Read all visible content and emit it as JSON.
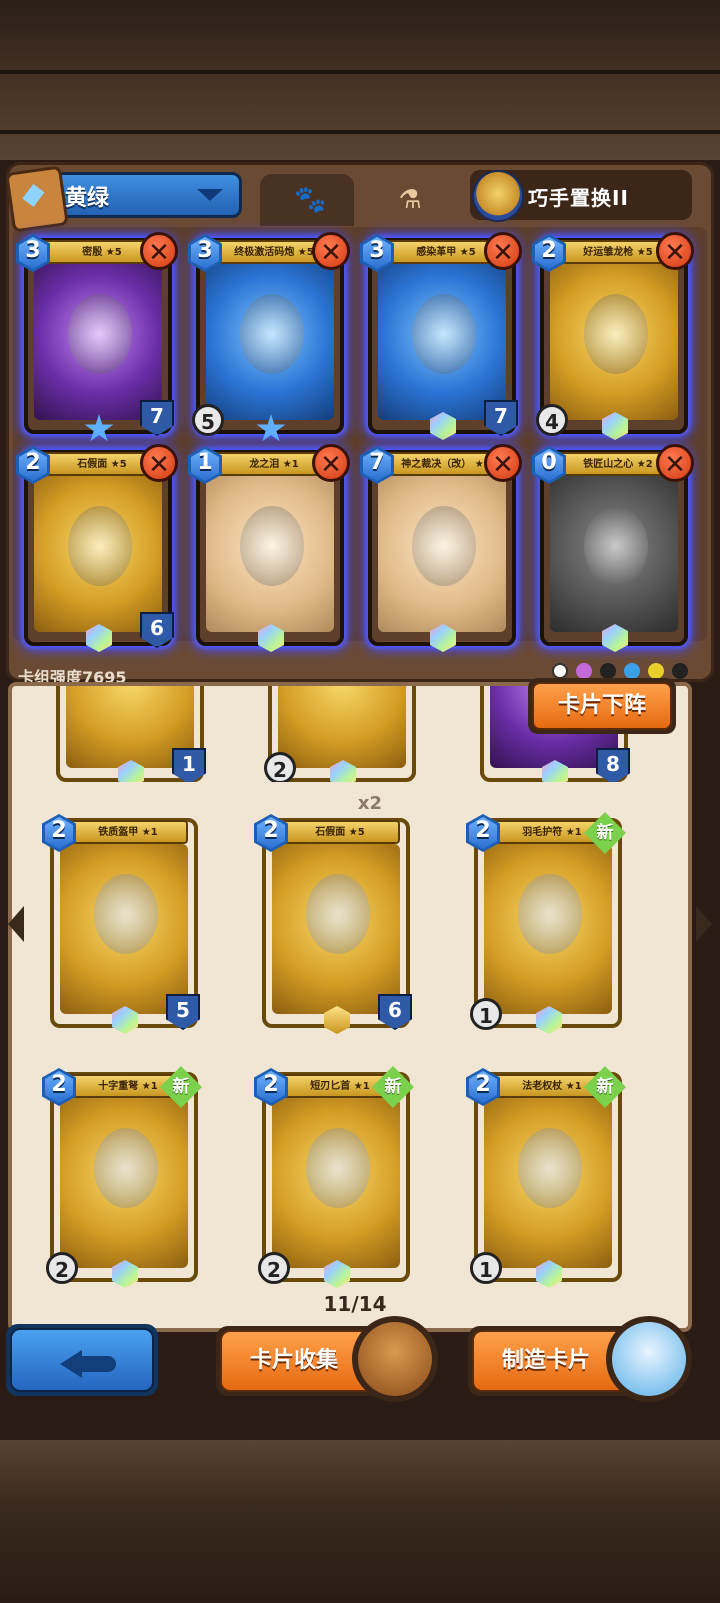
{
  "deck": {
    "name": "黄绿",
    "strength_label": "卡组强度7695",
    "tabs": [
      "paw-icon",
      "potion-icon"
    ],
    "skill": "巧手置换II"
  },
  "deck_cards": [
    {
      "title": "密殷 ★5",
      "cost": "3",
      "hp": "7",
      "color": "purple"
    },
    {
      "title": "终极激活码炮 ★5",
      "cost": "3",
      "hp": "",
      "atk": "5",
      "color": "blue"
    },
    {
      "title": "感染革甲 ★5",
      "cost": "3",
      "hp": "7",
      "color": "blue"
    },
    {
      "title": "好运雏龙枪 ★5",
      "cost": "2",
      "hp": "",
      "atk": "4",
      "color": "gold"
    },
    {
      "title": "石假面 ★5",
      "cost": "2",
      "hp": "6",
      "color": "gold"
    },
    {
      "title": "龙之泪 ★1",
      "cost": "1",
      "hp": "",
      "color": "beige"
    },
    {
      "title": "神之裁决（改） ★1",
      "cost": "7",
      "hp": "",
      "color": "beige"
    },
    {
      "title": "铁匠山之心 ★2",
      "cost": "0",
      "hp": "",
      "color": "dark"
    }
  ],
  "library": {
    "partial_row": [
      {
        "hp": "1"
      },
      {
        "atk": "2"
      },
      {
        "hp": "8"
      }
    ],
    "dup_label": "x2",
    "cards": [
      {
        "title": "铁质盔甲 ★1",
        "cost": "2",
        "hp": "5",
        "atk": "",
        "new": ""
      },
      {
        "title": "石假面 ★5",
        "cost": "2",
        "hp": "6",
        "atk": "",
        "new": ""
      },
      {
        "title": "羽毛护符 ★1",
        "cost": "2",
        "hp": "",
        "atk": "1",
        "new": "新"
      },
      {
        "title": "十字重弩 ★1",
        "cost": "2",
        "hp": "",
        "atk": "2",
        "new": "新"
      },
      {
        "title": "短刃匕首 ★1",
        "cost": "2",
        "hp": "",
        "atk": "2",
        "new": "新"
      },
      {
        "title": "法老权杖 ★1",
        "cost": "2",
        "hp": "",
        "atk": "1",
        "new": "新"
      }
    ],
    "page": "11/14",
    "remove_button": "卡片下阵"
  },
  "bottom": {
    "collect": "卡片收集",
    "craft": "制造卡片"
  },
  "colors": {
    "accent_orange": "#e56a12",
    "accent_blue": "#2466c0",
    "deck_glow": "#3f49ff"
  }
}
